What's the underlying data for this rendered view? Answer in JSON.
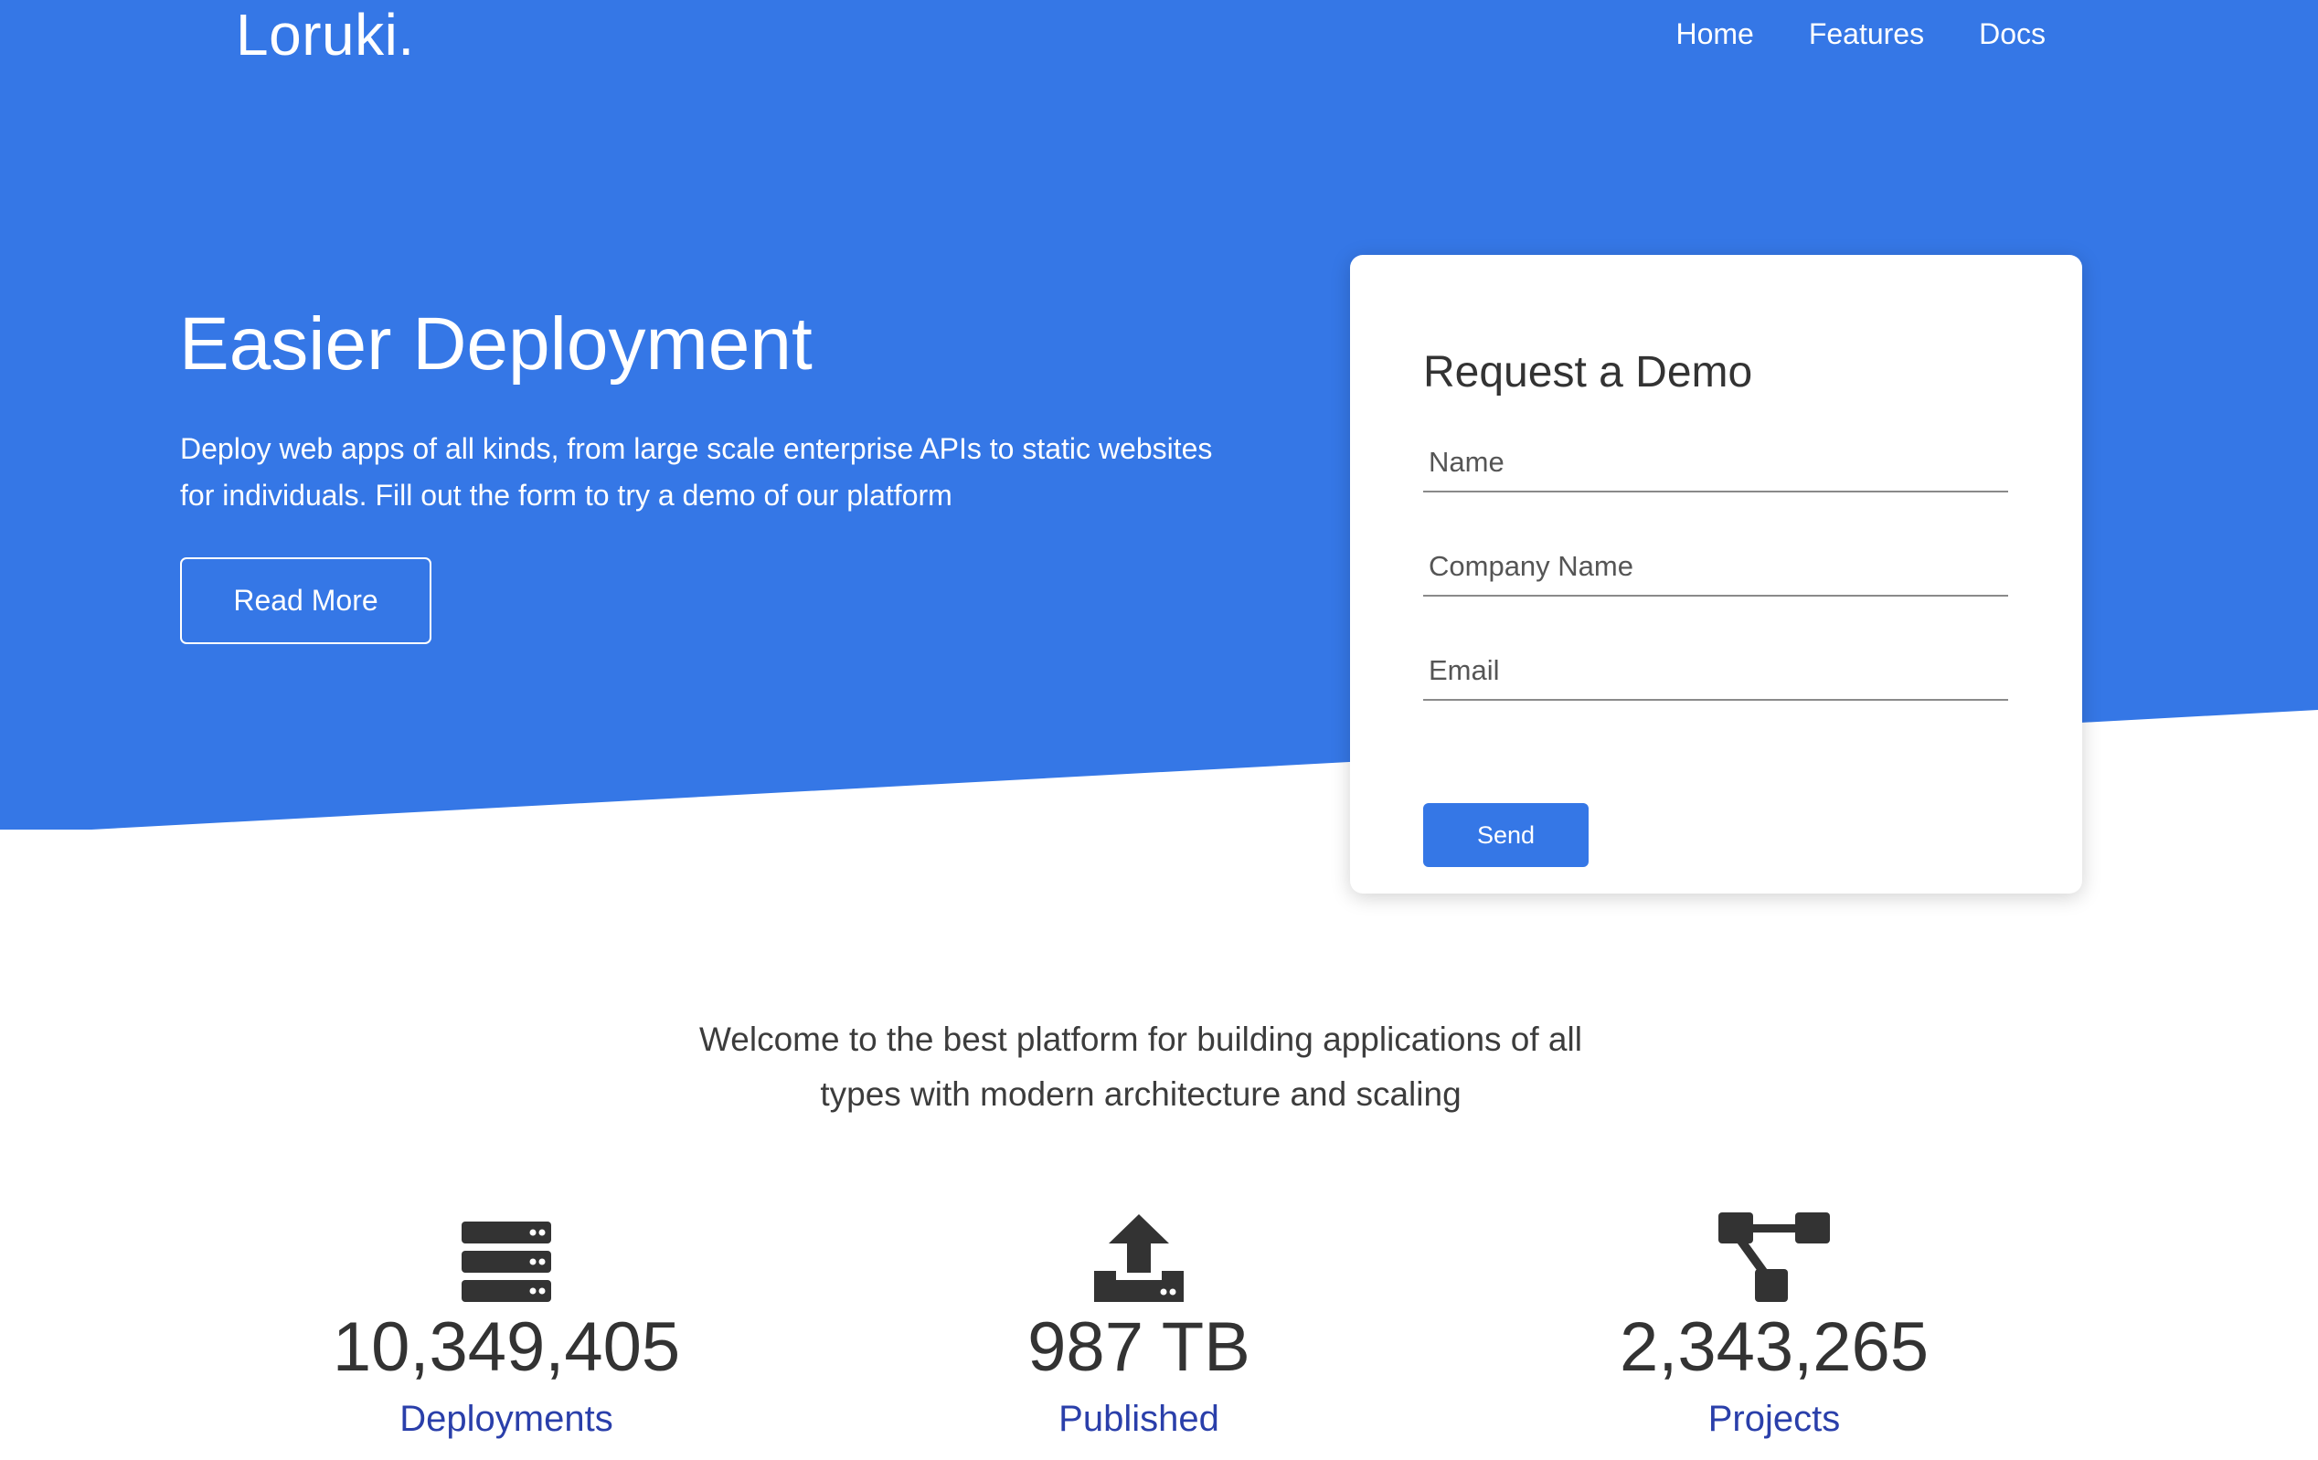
{
  "colors": {
    "hero_blue": "#3577e6",
    "label_blue": "#2a3faa",
    "stat_dark": "#333333"
  },
  "header": {
    "brand": "Loruki.",
    "nav": [
      {
        "label": "Home"
      },
      {
        "label": "Features"
      },
      {
        "label": "Docs"
      }
    ]
  },
  "hero": {
    "title": "Easier Deployment",
    "text": "Deploy web apps of all kinds, from large scale enterprise APIs to static websites for individuals. Fill out the form to try a demo of our platform",
    "read_more_label": "Read More"
  },
  "demo_form": {
    "title": "Request a Demo",
    "name_placeholder": "Name",
    "company_placeholder": "Company Name",
    "email_placeholder": "Email",
    "send_label": "Send"
  },
  "welcome": {
    "text": "Welcome to the best platform for building applications of all types with modern architecture and scaling"
  },
  "stats": [
    {
      "icon": "server-icon",
      "value": "10,349,405",
      "label": "Deployments"
    },
    {
      "icon": "upload-icon",
      "value": "987 TB",
      "label": "Published"
    },
    {
      "icon": "project-diagram-icon",
      "value": "2,343,265",
      "label": "Projects"
    }
  ]
}
